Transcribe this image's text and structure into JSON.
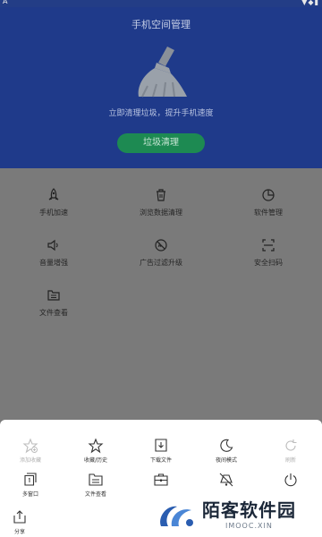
{
  "status_bar": {
    "left_indicator": "A",
    "right_icons": "▼◆▮"
  },
  "hero": {
    "title": "手机空间管理",
    "subtitle": "立即清理垃圾，提升手机速度",
    "clean_button": "垃圾清理",
    "colors": {
      "background": "#1f3a8a",
      "button": "#1d8a52"
    }
  },
  "tools": [
    {
      "label": "手机加速",
      "icon": "rocket-icon"
    },
    {
      "label": "浏览数据清理",
      "icon": "trash-icon"
    },
    {
      "label": "软件管理",
      "icon": "pie-chart-icon"
    },
    {
      "label": "音量增强",
      "icon": "speaker-icon"
    },
    {
      "label": "广告过滤升级",
      "icon": "ad-block-icon"
    },
    {
      "label": "安全扫码",
      "icon": "scan-icon"
    },
    {
      "label": "文件查看",
      "icon": "folder-icon"
    }
  ],
  "menu": [
    {
      "label": "添加收藏",
      "icon": "star-add-icon",
      "disabled": true
    },
    {
      "label": "收藏/历史",
      "icon": "star-icon"
    },
    {
      "label": "下载文件",
      "icon": "download-icon"
    },
    {
      "label": "夜间模式",
      "icon": "moon-icon"
    },
    {
      "label": "刷新",
      "icon": "refresh-icon",
      "disabled": true
    },
    {
      "label": "多窗口",
      "icon": "windows-icon"
    },
    {
      "label": "文件查看",
      "icon": "file-list-icon"
    },
    {
      "label": "",
      "icon": "toolbox-icon"
    },
    {
      "label": "",
      "icon": "no-image-icon"
    },
    {
      "label": "",
      "icon": "power-icon"
    },
    {
      "label": "分享",
      "icon": "share-icon"
    }
  ],
  "watermark": {
    "text": "陌客软件园",
    "url": "IMOOC.XIN"
  }
}
